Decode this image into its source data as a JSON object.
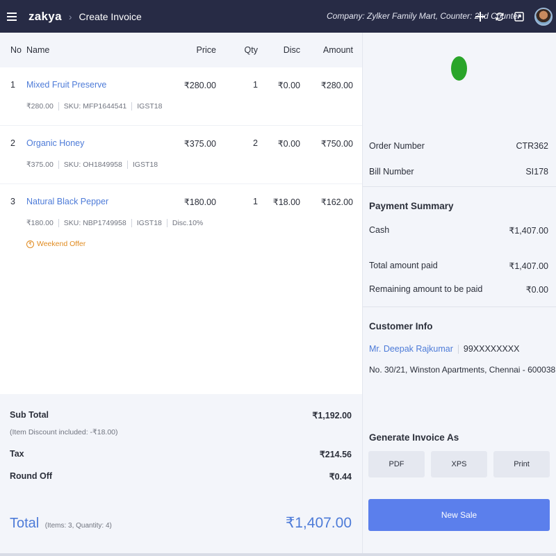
{
  "header": {
    "logo": "zakya",
    "crumb_sep": "›",
    "page_title": "Create Invoice",
    "company_info": "Company: Zylker Family Mart,  Counter: 2nd Counter",
    "icons": [
      "menu-icon",
      "plus-icon",
      "refresh-icon",
      "exit-icon",
      "avatar"
    ]
  },
  "table": {
    "headers": {
      "no": "No",
      "name": "Name",
      "price": "Price",
      "qty": "Qty",
      "disc": "Disc",
      "amount": "Amount"
    },
    "items": [
      {
        "no": "1",
        "name": "Mixed Fruit Preserve",
        "price": "₹280.00",
        "qty": "1",
        "disc": "₹0.00",
        "amount": "₹280.00",
        "unit_price": "₹280.00",
        "sku": "SKU: MFP1644541",
        "tax": "IGST18",
        "discount": "",
        "offer": ""
      },
      {
        "no": "2",
        "name": "Organic Honey",
        "price": "₹375.00",
        "qty": "2",
        "disc": "₹0.00",
        "amount": "₹750.00",
        "unit_price": "₹375.00",
        "sku": "SKU: OH1849958",
        "tax": "IGST18",
        "discount": "",
        "offer": ""
      },
      {
        "no": "3",
        "name": "Natural Black Pepper",
        "price": "₹180.00",
        "qty": "1",
        "disc": "₹18.00",
        "amount": "₹162.00",
        "unit_price": "₹180.00",
        "sku": "SKU: NBP1749958",
        "tax": "IGST18",
        "discount": "Disc.10%",
        "offer": "Weekend Offer"
      }
    ]
  },
  "totals": {
    "subtotal_label": "Sub Total",
    "subtotal_value": "₹1,192.00",
    "discount_note": "(Item Discount included: -₹18.00)",
    "tax_label": "Tax",
    "tax_value": "₹214.56",
    "roundoff_label": "Round Off",
    "roundoff_value": "₹0.44",
    "total_label": "Total",
    "total_meta": "(Items: 3, Quantity: 4)",
    "total_value": "₹1,407.00"
  },
  "order": {
    "order_number_label": "Order Number",
    "order_number_value": "CTR362",
    "bill_number_label": "Bill Number",
    "bill_number_value": "SI178",
    "status_color": "#2aa52a"
  },
  "payment": {
    "heading": "Payment Summary",
    "cash_label": "Cash",
    "cash_value": "₹1,407.00",
    "total_paid_label": "Total amount paid",
    "total_paid_value": "₹1,407.00",
    "remaining_label": "Remaining amount to be paid",
    "remaining_value": "₹0.00"
  },
  "customer": {
    "heading": "Customer Info",
    "name": "Mr. Deepak Rajkumar",
    "phone": "99XXXXXXXX",
    "address": "No. 30/21, Winston Apartments, Chennai - 600038"
  },
  "generate": {
    "heading": "Generate Invoice As",
    "pdf": "PDF",
    "xps": "XPS",
    "print": "Print"
  },
  "new_sale_label": "New Sale",
  "colors": {
    "accent": "#4d7bd8",
    "button": "#5b7fec",
    "topbar": "#272b45",
    "offer": "#e08a1e"
  }
}
